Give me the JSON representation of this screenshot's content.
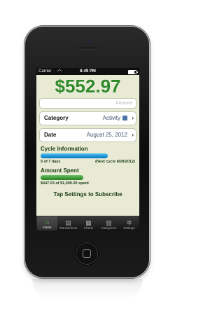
{
  "status_bar": {
    "carrier": "Carrier",
    "time": "8:49 PM"
  },
  "balance": "$552.97",
  "amount_field": {
    "placeholder": "Amount"
  },
  "form": {
    "category": {
      "label": "Category",
      "value": "Activity"
    },
    "date": {
      "label": "Date",
      "value": "August 25, 2012"
    }
  },
  "cycle": {
    "title": "Cycle Information",
    "progress": 0.71,
    "left_text": "5 of 7 days",
    "right_text": "(Next cycle 8/28/2012)"
  },
  "amount_spent": {
    "title": "Amount Spent",
    "progress": 0.45,
    "text": "$447.03 of $1,000.00 spent"
  },
  "subscribe_text": "Tap Settings to Subscribe",
  "tabs": [
    {
      "label": "Home",
      "icon": "home-icon",
      "active": true
    },
    {
      "label": "Transactions",
      "icon": "book-icon",
      "active": false
    },
    {
      "label": "Charts",
      "icon": "chart-icon",
      "active": false
    },
    {
      "label": "Categories",
      "icon": "archive-icon",
      "active": false
    },
    {
      "label": "Settings",
      "icon": "gear-icon",
      "active": false
    }
  ],
  "colors": {
    "balance_green": "#2f8a2a",
    "cycle_bar_blue": "#1a93d6",
    "spent_bar_green": "#3c9a36",
    "category_swatch": "#4a74a8"
  }
}
